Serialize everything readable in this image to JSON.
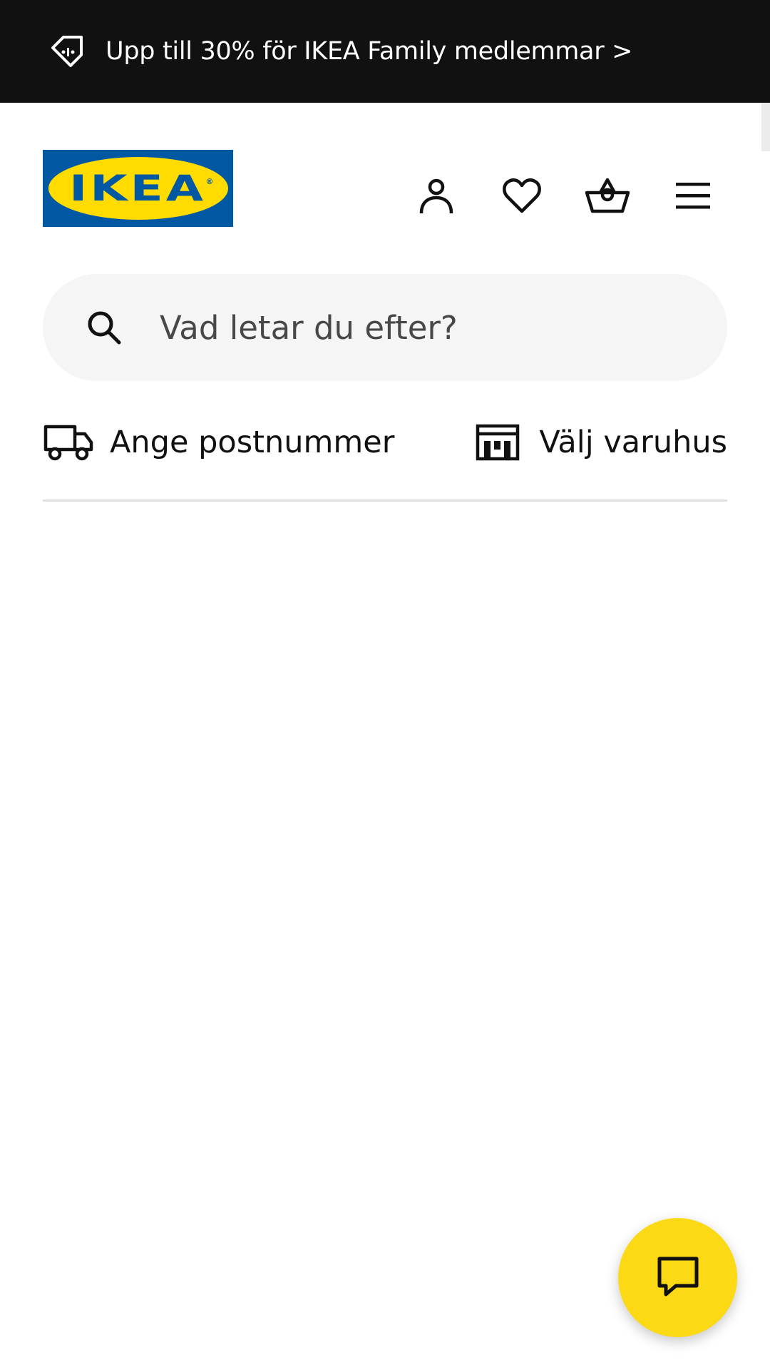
{
  "promo": {
    "text": "Upp till 30% för IKEA Family medlemmar >",
    "icon": "tag-icon"
  },
  "header": {
    "logo_text": "IKEA",
    "logo_reg": "®",
    "icons": [
      "user-icon",
      "heart-icon",
      "basket-icon",
      "menu-icon"
    ]
  },
  "search": {
    "placeholder": "Vad letar du efter?",
    "value": ""
  },
  "location": {
    "postcode_label": "Ange postnummer",
    "store_label": "Välj varuhus"
  },
  "colors": {
    "brand_blue": "#0058a3",
    "brand_yellow": "#ffdb00",
    "fab_yellow": "#fbd914",
    "banner_bg": "#111111"
  }
}
